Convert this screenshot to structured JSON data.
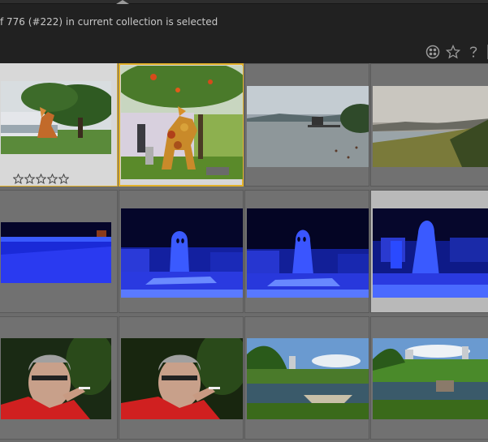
{
  "header": {
    "status": "f 776 (#222) in current collection is selected"
  },
  "toolbar": {
    "icons": [
      "grouping-icon",
      "star-icon",
      "help-icon"
    ]
  },
  "grid": {
    "rows": [
      [
        "sculpture-horse-1",
        "sculpture-horse-2-selected",
        "lake-pier",
        "lake-hills-sunset"
      ],
      [
        "blue-lights-1",
        "blue-ghost-1",
        "blue-ghost-2",
        "blue-ghost-3"
      ],
      [
        "man-smoking-1",
        "man-smoking-2",
        "japanese-garden-1",
        "japanese-garden-2"
      ]
    ],
    "rating_stars": 5
  }
}
